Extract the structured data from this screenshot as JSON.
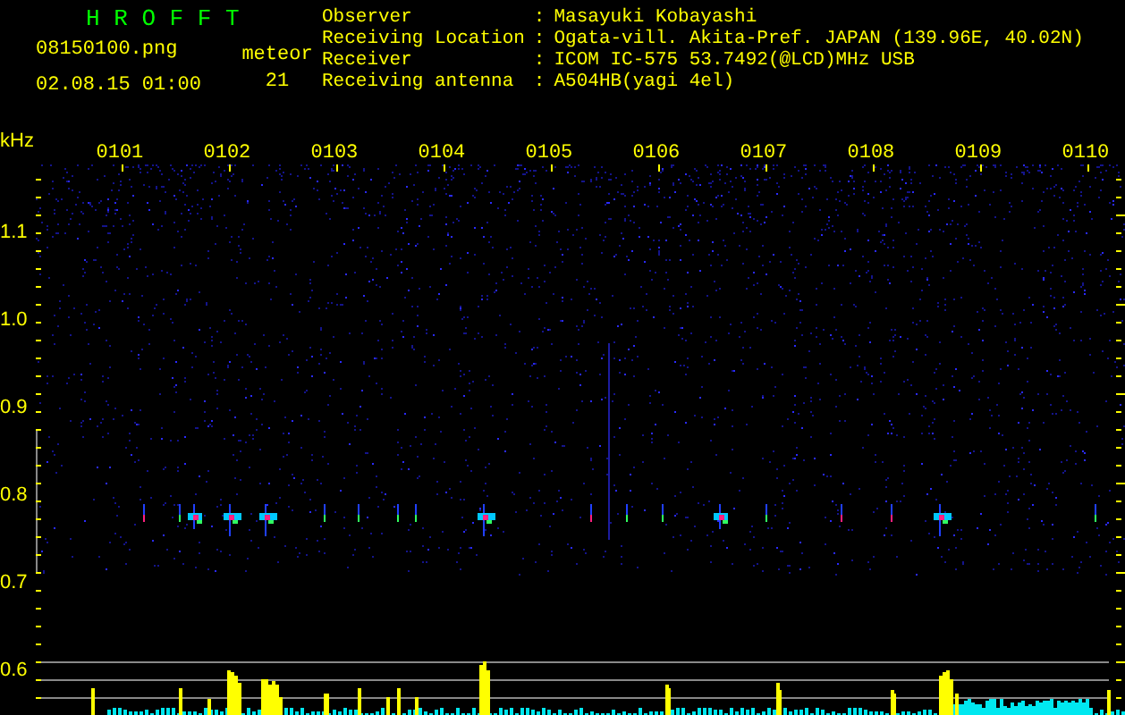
{
  "app_title": "H R O F F T",
  "file_name": "08150100.png",
  "date_time": "02.08.15 01:00",
  "meteor": {
    "label": "meteor",
    "count": "21"
  },
  "info": [
    {
      "label": "Observer",
      "separator": ":",
      "value": "Masayuki Kobayashi"
    },
    {
      "label": "Receiving Location",
      "separator": ":",
      "value": "Ogata-vill. Akita-Pref. JAPAN (139.96E, 40.02N)"
    },
    {
      "label": "Receiver",
      "separator": ":",
      "value": "ICOM IC-575 53.7492(@LCD)MHz USB"
    },
    {
      "label": "Receiving antenna",
      "separator": ":",
      "value": "A504HB(yagi 4el)"
    }
  ],
  "plot": {
    "unit": "kHz",
    "y_labels": [
      "1.1",
      "1.0",
      "0.9",
      "0.8",
      "0.7",
      "0.6"
    ],
    "time_labels": [
      "0101",
      "0102",
      "0103",
      "0104",
      "0105",
      "0106",
      "0107",
      "0108",
      "0109",
      "0110"
    ]
  }
}
